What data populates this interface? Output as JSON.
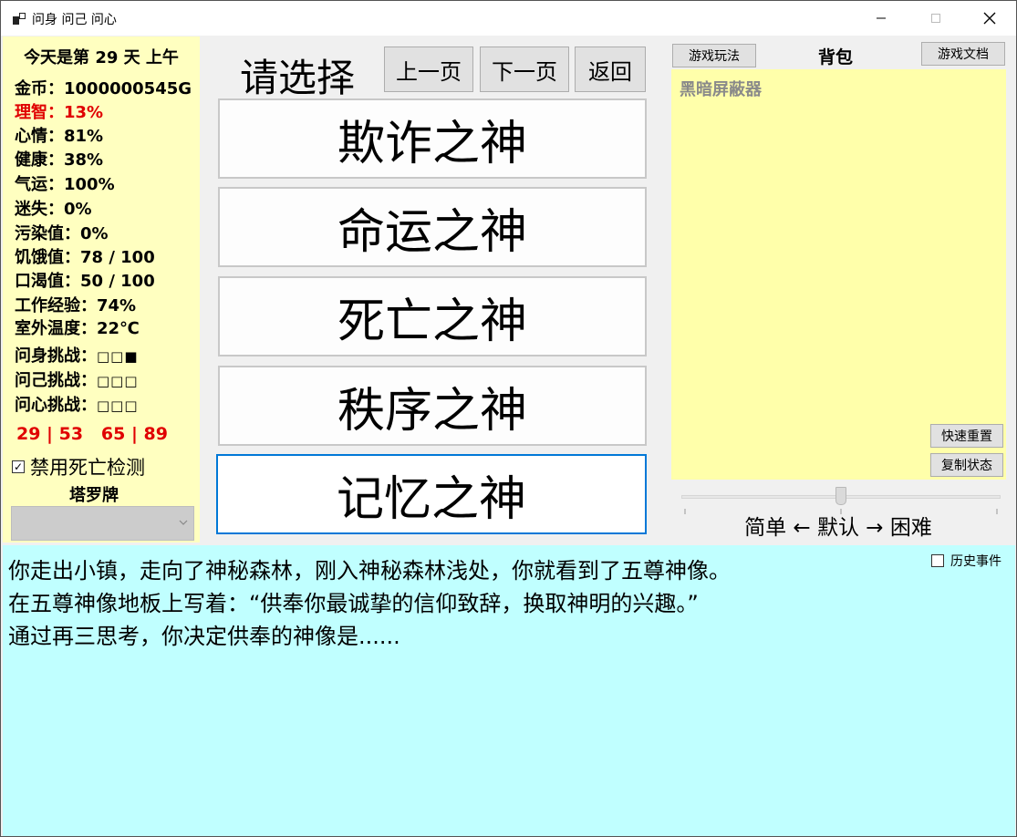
{
  "window": {
    "title": "问身 问己 问心",
    "minimize_glyph": "—",
    "maximize_glyph": "☐",
    "close_glyph": "✕"
  },
  "stats": {
    "day_line": "今天是第 29 天 上午",
    "items": [
      {
        "label": "金币：",
        "value": "1000000545G",
        "color": "#000000"
      },
      {
        "label": "理智：",
        "value": "13%",
        "color": "#e00000"
      },
      {
        "label": "心情：",
        "value": "81%",
        "color": "#000000"
      },
      {
        "label": "健康：",
        "value": "38%",
        "color": "#000000"
      },
      {
        "label": "气运：",
        "value": "100%",
        "color": "#000000"
      },
      {
        "label": "迷失：",
        "value": "0%",
        "color": "#000000"
      },
      {
        "label": "污染值：",
        "value": "0%",
        "color": "#000000"
      },
      {
        "label": "饥饿值：",
        "value": "78 / 100",
        "color": "#000000"
      },
      {
        "label": "口渴值：",
        "value": "50 / 100",
        "color": "#000000"
      },
      {
        "label": "工作经验：",
        "value": "74%",
        "color": "#000000"
      },
      {
        "label": "室外温度：",
        "value": "22℃",
        "color": "#000000"
      }
    ],
    "challenges": [
      {
        "label": "问身挑战：",
        "value": "□□■"
      },
      {
        "label": "问己挑战：",
        "value": "□□□"
      },
      {
        "label": "问心挑战：",
        "value": "□□□"
      }
    ],
    "score_line": "29 | 53   65 | 89",
    "disable_death_check": {
      "label": "禁用死亡检测",
      "checked": true,
      "check_glyph": "✓"
    },
    "tarot_label": "塔罗牌",
    "tarot_value": ""
  },
  "selection": {
    "title": "请选择",
    "prev_page": "上一页",
    "next_page": "下一页",
    "back": "返回",
    "options": [
      "欺诈之神",
      "命运之神",
      "死亡之神",
      "秩序之神",
      "记忆之神"
    ]
  },
  "inventory": {
    "howto_button": "游戏玩法",
    "title": "背包",
    "docs_button": "游戏文档",
    "items": [
      "黑暗屏蔽器"
    ],
    "quick_reset_button": "快速重置",
    "copy_state_button": "复制状态",
    "difficulty_label": "简单 ← 默认 → 困难",
    "difficulty_level": 0.5
  },
  "story": {
    "lines": [
      "你走出小镇，走向了神秘森林，刚入神秘森林浅处，你就看到了五尊神像。",
      "在五尊神像地板上写着：“供奉你最诚挚的信仰致辞，换取神明的兴趣。”",
      "通过再三思考，你决定供奉的神像是......"
    ],
    "history_label": "历史事件",
    "history_checked": false
  }
}
